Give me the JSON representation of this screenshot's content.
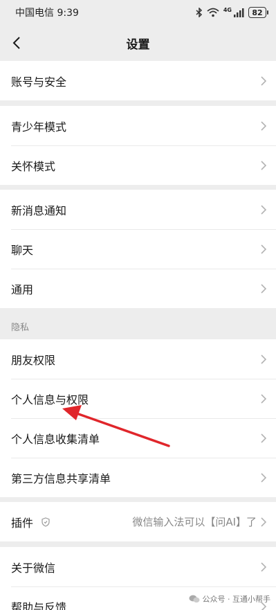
{
  "status_bar": {
    "carrier_time": "中国电信 9:39",
    "signal_text": "4G",
    "battery": "82"
  },
  "nav": {
    "title": "设置"
  },
  "groups": {
    "account": [
      "账号与安全"
    ],
    "modes": [
      "青少年模式",
      "关怀模式"
    ],
    "general": [
      "新消息通知",
      "聊天",
      "通用"
    ],
    "privacy_label": "隐私",
    "privacy": [
      "朋友权限",
      "个人信息与权限",
      "个人信息收集清单",
      "第三方信息共享清单"
    ],
    "plugins": {
      "label": "插件",
      "value": "微信输入法可以【问AI】了"
    },
    "about": [
      "关于微信",
      "帮助与反馈"
    ]
  },
  "watermark": "公众号 · 互通小帮手",
  "colors": {
    "annotation_arrow": "#e0262b",
    "background": "#ededed"
  }
}
